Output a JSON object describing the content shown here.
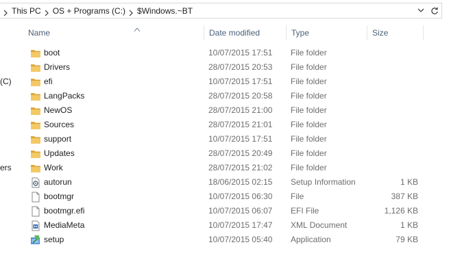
{
  "address_bar": {
    "crumbs": [
      "This PC",
      "OS + Programs (C:)",
      "$Windows.~BT"
    ]
  },
  "nav_pane": {
    "fragments": [
      "(C)",
      "ers"
    ]
  },
  "columns": {
    "name": "Name",
    "date": "Date modified",
    "type": "Type",
    "size": "Size"
  },
  "files": [
    {
      "name": "boot",
      "date": "10/07/2015 17:51",
      "type": "File folder",
      "size": "",
      "icon": "folder-icon"
    },
    {
      "name": "Drivers",
      "date": "28/07/2015 20:53",
      "type": "File folder",
      "size": "",
      "icon": "folder-icon"
    },
    {
      "name": "efi",
      "date": "10/07/2015 17:51",
      "type": "File folder",
      "size": "",
      "icon": "folder-icon"
    },
    {
      "name": "LangPacks",
      "date": "28/07/2015 20:58",
      "type": "File folder",
      "size": "",
      "icon": "folder-icon"
    },
    {
      "name": "NewOS",
      "date": "28/07/2015 21:00",
      "type": "File folder",
      "size": "",
      "icon": "folder-icon"
    },
    {
      "name": "Sources",
      "date": "28/07/2015 21:01",
      "type": "File folder",
      "size": "",
      "icon": "folder-icon"
    },
    {
      "name": "support",
      "date": "10/07/2015 17:51",
      "type": "File folder",
      "size": "",
      "icon": "folder-icon"
    },
    {
      "name": "Updates",
      "date": "28/07/2015 20:49",
      "type": "File folder",
      "size": "",
      "icon": "folder-icon"
    },
    {
      "name": "Work",
      "date": "28/07/2015 21:02",
      "type": "File folder",
      "size": "",
      "icon": "folder-icon"
    },
    {
      "name": "autorun",
      "date": "18/06/2015 02:15",
      "type": "Setup Information",
      "size": "1 KB",
      "icon": "setup-info-icon"
    },
    {
      "name": "bootmgr",
      "date": "10/07/2015 06:30",
      "type": "File",
      "size": "387 KB",
      "icon": "blank-file-icon"
    },
    {
      "name": "bootmgr.efi",
      "date": "10/07/2015 06:07",
      "type": "EFI File",
      "size": "1,126 KB",
      "icon": "blank-file-icon"
    },
    {
      "name": "MediaMeta",
      "date": "10/07/2015 17:47",
      "type": "XML Document",
      "size": "1 KB",
      "icon": "xml-file-icon"
    },
    {
      "name": "setup",
      "date": "10/07/2015 05:40",
      "type": "Application",
      "size": "79 KB",
      "icon": "setup-app-icon"
    }
  ],
  "colors": {
    "folder": "#e8b84a",
    "header_text": "#4c607a",
    "detail_text": "#6d6d6d"
  }
}
